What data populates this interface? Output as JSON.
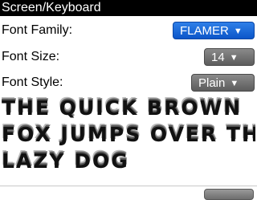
{
  "window": {
    "title": "Screen/Keyboard"
  },
  "settings": {
    "font_family": {
      "label": "Font Family:",
      "value": "FLAMER"
    },
    "font_size": {
      "label": "Font Size:",
      "value": "14"
    },
    "font_style": {
      "label": "Font Style:",
      "value": "Plain"
    }
  },
  "preview": {
    "lines": [
      "The quick brown",
      "fox jumps over the",
      "lazy dog"
    ]
  },
  "colors": {
    "titlebar_bg": "#000000",
    "accent_dropdown": "#0b56c9",
    "gray_dropdown": "#5c5c5c"
  },
  "icons": {
    "dropdown_arrow": "triangle-down"
  }
}
